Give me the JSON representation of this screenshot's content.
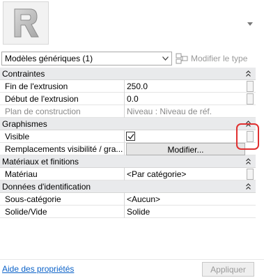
{
  "header": {
    "thumbnail_icon": "revit-r-logo-icon",
    "menu_icon": "chevron-down-icon"
  },
  "selector": {
    "type_label": "Modèles génériques (1)",
    "edit_type_label": "Modifier le type"
  },
  "groups": [
    {
      "label": "Contraintes",
      "rows": [
        {
          "name": "Fin de l'extrusion",
          "value": "250.0",
          "disabled": false
        },
        {
          "name": "Début de l'extrusion",
          "value": "0.0",
          "disabled": false
        },
        {
          "name": "Plan de construction",
          "value": "Niveau : Niveau de réf.",
          "disabled": true
        }
      ]
    },
    {
      "label": "Graphismes",
      "rows": [
        {
          "name": "Visible",
          "value": "checked"
        },
        {
          "name": "Remplacements visibilité / gra...",
          "value": "Modifier..."
        }
      ]
    },
    {
      "label": "Matériaux et finitions",
      "rows": [
        {
          "name": "Matériau",
          "value": "<Par catégorie>"
        }
      ]
    },
    {
      "label": "Données d'identification",
      "rows": [
        {
          "name": "Sous-catégorie",
          "value": "<Aucun>"
        },
        {
          "name": "Solide/Vide",
          "value": "Solide"
        }
      ]
    }
  ],
  "footer": {
    "help_link": "Aide des propriétés",
    "apply_label": "Appliquer"
  },
  "colors": {
    "group_bg": "#e9eaec",
    "highlight": "#e03030",
    "link": "#0b62c8"
  }
}
